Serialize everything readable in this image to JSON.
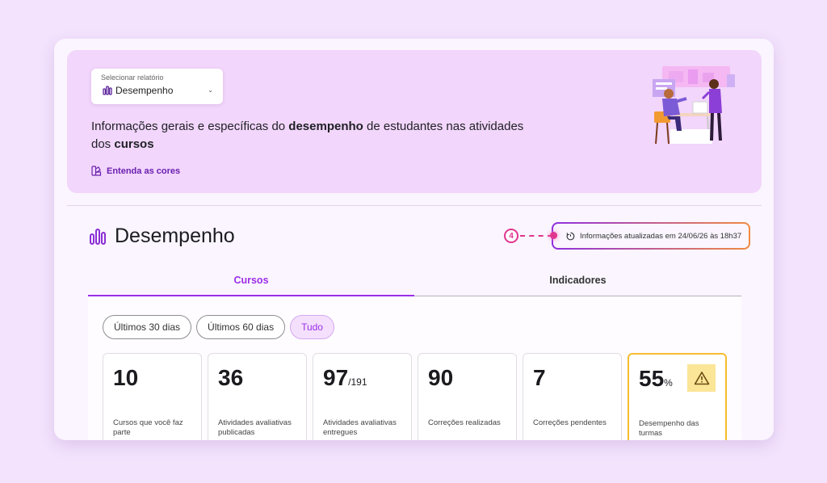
{
  "report_select": {
    "caption": "Selecionar relatório",
    "value": "Desempenho"
  },
  "hero": {
    "text_part1": "Informações gerais e específicas do ",
    "text_bold1": "desempenho",
    "text_part2": " de estudantes nas atividades dos ",
    "text_bold2": "cursos",
    "colors_link": "Entenda as cores"
  },
  "section": {
    "title": "Desempenho",
    "callout_number": "4",
    "updated_text": "Informações atualizadas em 24/06/26 às 18h37"
  },
  "tabs": [
    {
      "label": "Cursos"
    },
    {
      "label": "Indicadores"
    }
  ],
  "filters": [
    {
      "label": "Últimos 30 dias"
    },
    {
      "label": "Últimos 60 dias"
    },
    {
      "label": "Tudo"
    }
  ],
  "stats": [
    {
      "value": "10",
      "suffix": "",
      "label": "Cursos que você faz parte"
    },
    {
      "value": "36",
      "suffix": "",
      "label": "Atividades avaliativas publicadas"
    },
    {
      "value": "97",
      "suffix": "/191",
      "label": "Atividades avaliativas entregues"
    },
    {
      "value": "90",
      "suffix": "",
      "label": "Correções realizadas"
    },
    {
      "value": "7",
      "suffix": "",
      "label": "Correções pendentes"
    },
    {
      "value": "55",
      "suffix": "%",
      "label": "Desempenho das turmas"
    }
  ],
  "colors": {
    "accent": "#9d2ee8",
    "link": "#6a1fb0",
    "callout": "#e0358f",
    "warning": "#f6bd2d"
  }
}
